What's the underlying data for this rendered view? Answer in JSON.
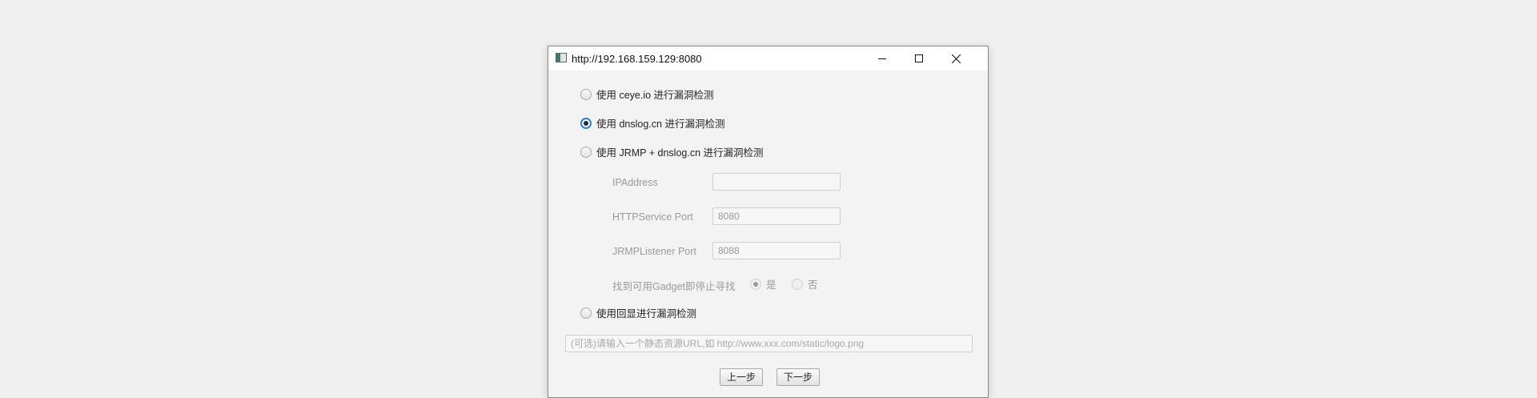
{
  "window": {
    "title": "http://192.168.159.129:8080",
    "icon": "java-app-icon"
  },
  "options": [
    {
      "label": "使用 ceye.io 进行漏洞检测",
      "selected": false
    },
    {
      "label": "使用 dnslog.cn 进行漏洞检测",
      "selected": true
    },
    {
      "label": "使用 JRMP + dnslog.cn 进行漏洞检测",
      "selected": false
    },
    {
      "label": "使用回显进行漏洞检测",
      "selected": false
    }
  ],
  "jrmp": {
    "ip_label": "IPAddress",
    "ip_value": "",
    "http_port_label": "HTTPService Port",
    "http_port_value": "8080",
    "jrmp_port_label": "JRMPListener Port",
    "jrmp_port_value": "8088",
    "gadget_label": "找到可用Gadget即停止寻找",
    "gadget_yes": "是",
    "gadget_no": "否",
    "gadget_selected": "是"
  },
  "static_url": {
    "placeholder": "(可选)请输入一个静态资源URL,如 http://www.xxx.com/static/logo.png",
    "value": ""
  },
  "buttons": {
    "prev": "上一步",
    "next": "下一步"
  },
  "colors": {
    "accent": "#2b7fd0",
    "disabled_text": "#9a9a9a"
  }
}
